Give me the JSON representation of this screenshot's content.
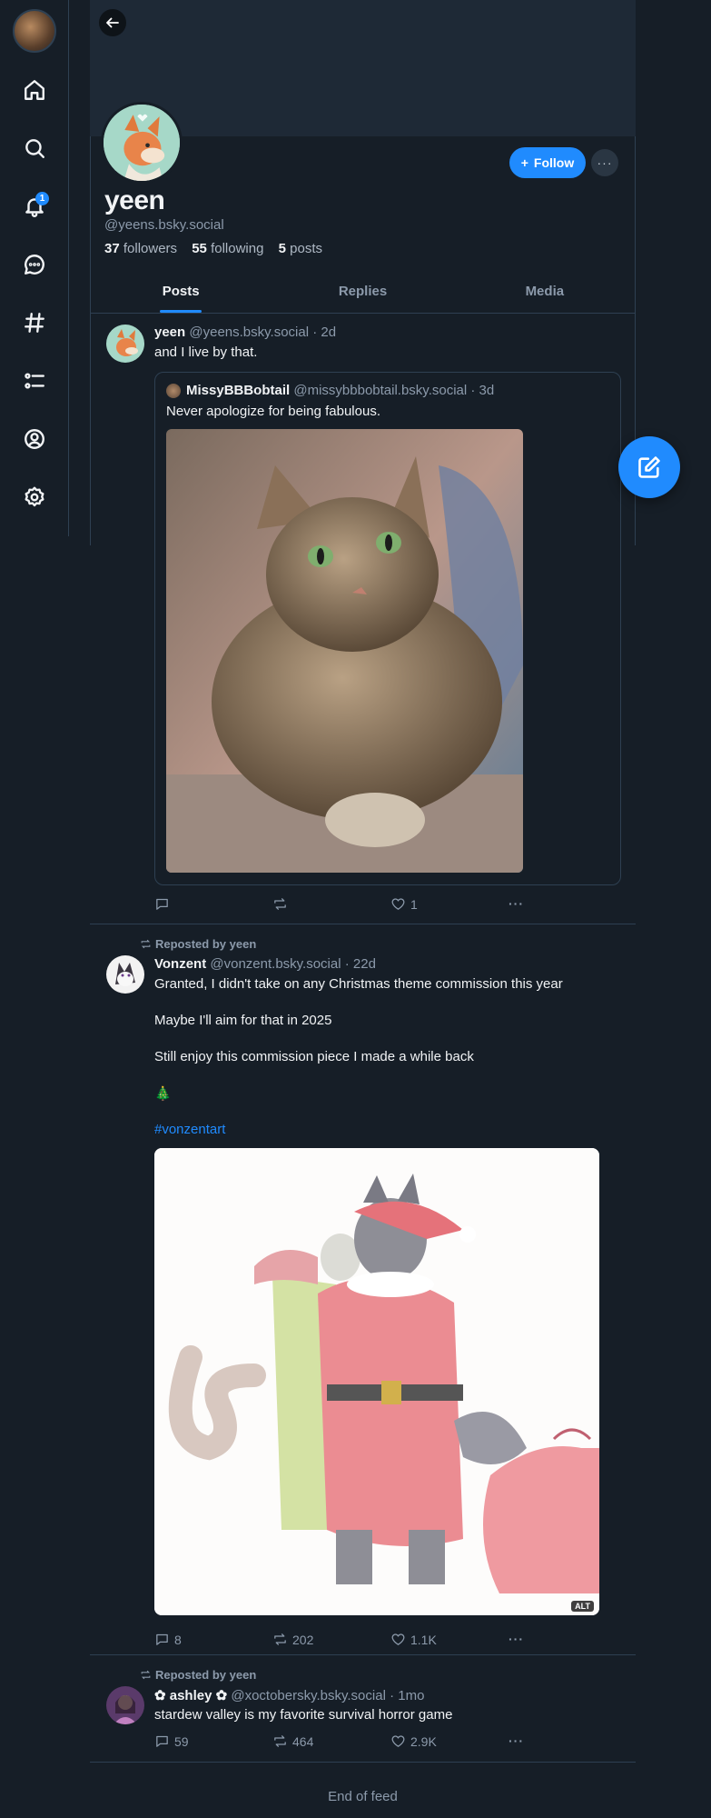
{
  "nav": {
    "notification_count": "1",
    "items": [
      "home-icon",
      "search-icon",
      "bell-icon",
      "chat-icon",
      "hashtag-icon",
      "list-icon",
      "profile-icon",
      "settings-icon"
    ]
  },
  "profile": {
    "display_name": "yeen",
    "handle": "@yeens.bsky.social",
    "followers_count": "37",
    "followers_label": "followers",
    "following_count": "55",
    "following_label": "following",
    "posts_count": "5",
    "posts_label": "posts",
    "follow_label": "Follow",
    "more_label": "···"
  },
  "tabs": [
    {
      "label": "Posts",
      "active": true
    },
    {
      "label": "Replies",
      "active": false
    },
    {
      "label": "Media",
      "active": false
    }
  ],
  "posts": [
    {
      "author_name": "yeen",
      "author_handle": "@yeens.bsky.social",
      "time": "· 2d",
      "text": "and I live by that.",
      "quote": {
        "author_name": "MissyBBBobtail",
        "author_handle": "@missybbbobtail.bsky.social",
        "time": "· 3d",
        "text": "Never apologize for being fabulous."
      },
      "replies": "",
      "reposts": "",
      "likes": "1"
    },
    {
      "repost_label": "Reposted by yeen",
      "author_name": "Vonzent",
      "author_handle": "@vonzent.bsky.social",
      "time": "· 22d",
      "text_lines": [
        "Granted, I didn't take on any Christmas theme commission this year",
        "Maybe I'll aim for that in 2025",
        "Still enjoy this commission piece I made a while back",
        "🎄"
      ],
      "hashtag": "#vonzentart",
      "alt_label": "ALT",
      "replies": "8",
      "reposts": "202",
      "likes": "1.1K"
    },
    {
      "repost_label": "Reposted by yeen",
      "author_name": "✿ ashley ✿",
      "author_handle": "@xoctobersky.bsky.social",
      "time": "· 1mo",
      "text": "stardew valley is my favorite survival horror game",
      "replies": "59",
      "reposts": "464",
      "likes": "2.9K"
    }
  ],
  "end_of_feed": "End of feed",
  "colors": {
    "accent": "#208bfe",
    "background": "#161e27",
    "border": "#2e4052",
    "muted": "#8c9aab"
  }
}
